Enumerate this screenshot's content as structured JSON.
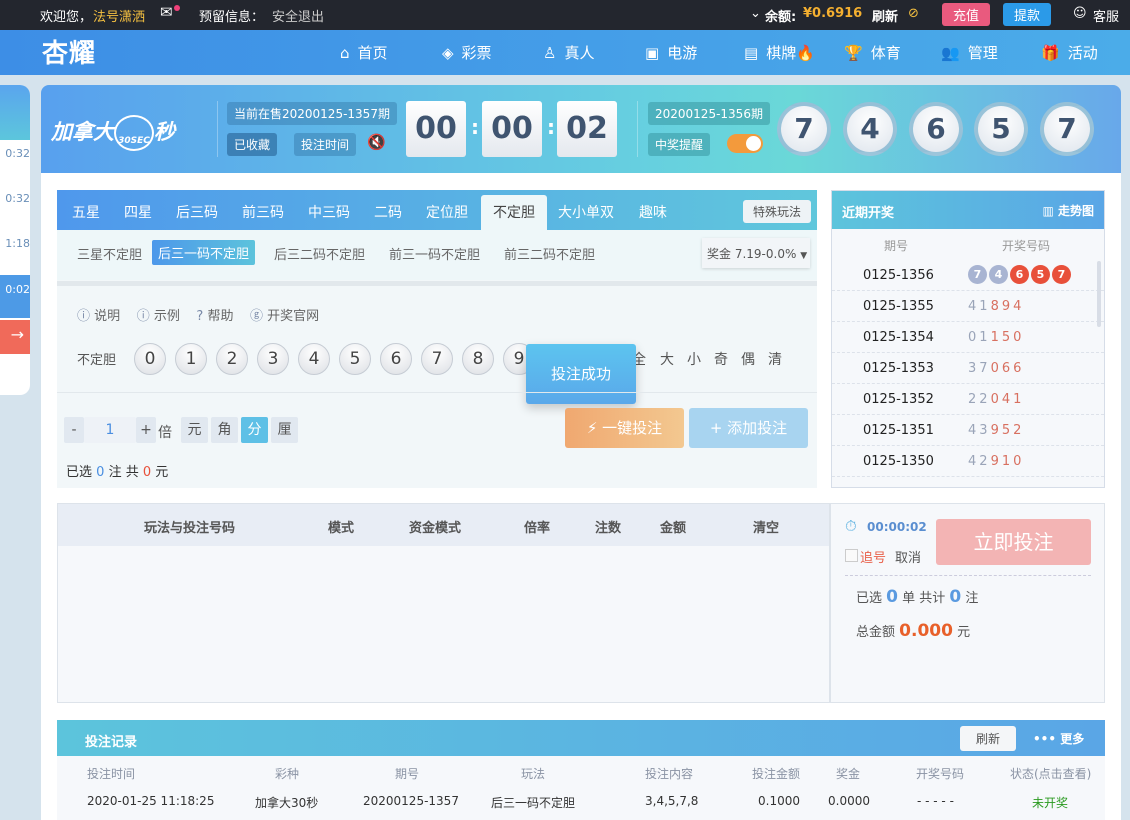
{
  "topbar": {
    "welcome": "欢迎您，",
    "username": "法号潇洒",
    "reserved": "预留信息：",
    "logout": "安全退出",
    "balance_label": "余额:",
    "balance": "¥0.6916",
    "refresh": "刷新",
    "recharge": "充值",
    "withdraw": "提款",
    "service": "客服"
  },
  "nav": {
    "logo": "杏耀",
    "items": [
      {
        "label": "首页",
        "icon": "⌂"
      },
      {
        "label": "彩票",
        "icon": "◈"
      },
      {
        "label": "真人",
        "icon": "♙"
      },
      {
        "label": "电游",
        "icon": "▣"
      },
      {
        "label": "棋牌",
        "icon": "▤"
      },
      {
        "label": "体育",
        "icon": "🏆"
      },
      {
        "label": "管理",
        "icon": "👥"
      },
      {
        "label": "活动",
        "icon": "🎁"
      }
    ]
  },
  "sidebar": {
    "times": [
      "0:32",
      "0:32",
      "1:18",
      "0:02"
    ]
  },
  "header": {
    "game_name": "加拿大",
    "game_suffix": "秒",
    "game_badge": "30SEC",
    "current_issue": "当前在售20200125-1357期",
    "favorited": "已收藏",
    "bet_time": "投注时间",
    "countdown": [
      "00",
      "00",
      "02"
    ],
    "last_issue": "20200125-1356期",
    "win_alert": "中奖提醒",
    "last_numbers": [
      "7",
      "4",
      "6",
      "5",
      "7"
    ]
  },
  "bet": {
    "tabs": [
      "五星",
      "四星",
      "后三码",
      "前三码",
      "中三码",
      "二码",
      "定位胆",
      "不定胆",
      "大小单双",
      "趣味"
    ],
    "active_tab": 7,
    "special": "特殊玩法",
    "subtabs": [
      "三星不定胆",
      "后三一码不定胆",
      "后三二码不定胆",
      "前三一码不定胆",
      "前三二码不定胆"
    ],
    "active_sub": 1,
    "prize": "奖金 7.19-0.0%",
    "links": [
      "说明",
      "示例",
      "帮助",
      "开奖官网"
    ],
    "row_label": "不定胆",
    "numbers": [
      "0",
      "1",
      "2",
      "3",
      "4",
      "5",
      "6",
      "7",
      "8",
      "9"
    ],
    "quick": [
      "全",
      "大",
      "小",
      "奇",
      "偶",
      "清"
    ],
    "toast": "投注成功",
    "multiplier": "1",
    "times_label": "倍",
    "units": [
      "元",
      "角",
      "分",
      "厘"
    ],
    "active_unit": 2,
    "one_click": "一键投注",
    "add": "添加投注",
    "selected_prefix": "已选",
    "selected_count": "0",
    "selected_mid": "注  共",
    "selected_amount": "0",
    "selected_suffix": "元"
  },
  "recent": {
    "title": "近期开奖",
    "trend": "走势图",
    "col_issue": "期号",
    "col_nums": "开奖号码",
    "rows": [
      {
        "issue": "0125-1356",
        "nums": [
          "7",
          "4",
          "6",
          "5",
          "7"
        ]
      },
      {
        "issue": "0125-1355",
        "nums": [
          "4",
          "1",
          "8",
          "9",
          "4"
        ]
      },
      {
        "issue": "0125-1354",
        "nums": [
          "0",
          "1",
          "1",
          "5",
          "0"
        ]
      },
      {
        "issue": "0125-1353",
        "nums": [
          "3",
          "7",
          "0",
          "6",
          "6"
        ]
      },
      {
        "issue": "0125-1352",
        "nums": [
          "2",
          "2",
          "0",
          "4",
          "1"
        ]
      },
      {
        "issue": "0125-1351",
        "nums": [
          "4",
          "3",
          "9",
          "5",
          "2"
        ]
      },
      {
        "issue": "0125-1350",
        "nums": [
          "4",
          "2",
          "9",
          "1",
          "0"
        ]
      }
    ]
  },
  "orders": {
    "headers": [
      "玩法与投注号码",
      "模式",
      "资金模式",
      "倍率",
      "注数",
      "金额",
      "清空"
    ]
  },
  "summary": {
    "timer": "00:00:02",
    "chase": "追号",
    "cancel": "取消",
    "submit": "立即投注",
    "sel_prefix": "已选",
    "sel_orders": "0",
    "sel_mid": "单 共计",
    "sel_bets": "0",
    "sel_suffix": "注",
    "total_label": "总金额",
    "total": "0.000",
    "total_unit": "元"
  },
  "records": {
    "title": "投注记录",
    "refresh": "刷新",
    "more": "更多",
    "headers": [
      "投注时间",
      "彩种",
      "期号",
      "玩法",
      "投注内容",
      "投注金额",
      "奖金",
      "开奖号码",
      "状态(点击查看)"
    ],
    "row": [
      "2020-01-25 11:18:25",
      "加拿大30秒",
      "20200125-1357",
      "后三一码不定胆",
      "3,4,5,7,8",
      "0.1000",
      "0.0000",
      "- - - - -",
      "未开奖"
    ]
  },
  "colors": {
    "accent": "#4a9ae8",
    "red": "#e8503a",
    "orange": "#f0a050",
    "pink": "#e95a7e",
    "green": "#2a9a20"
  }
}
